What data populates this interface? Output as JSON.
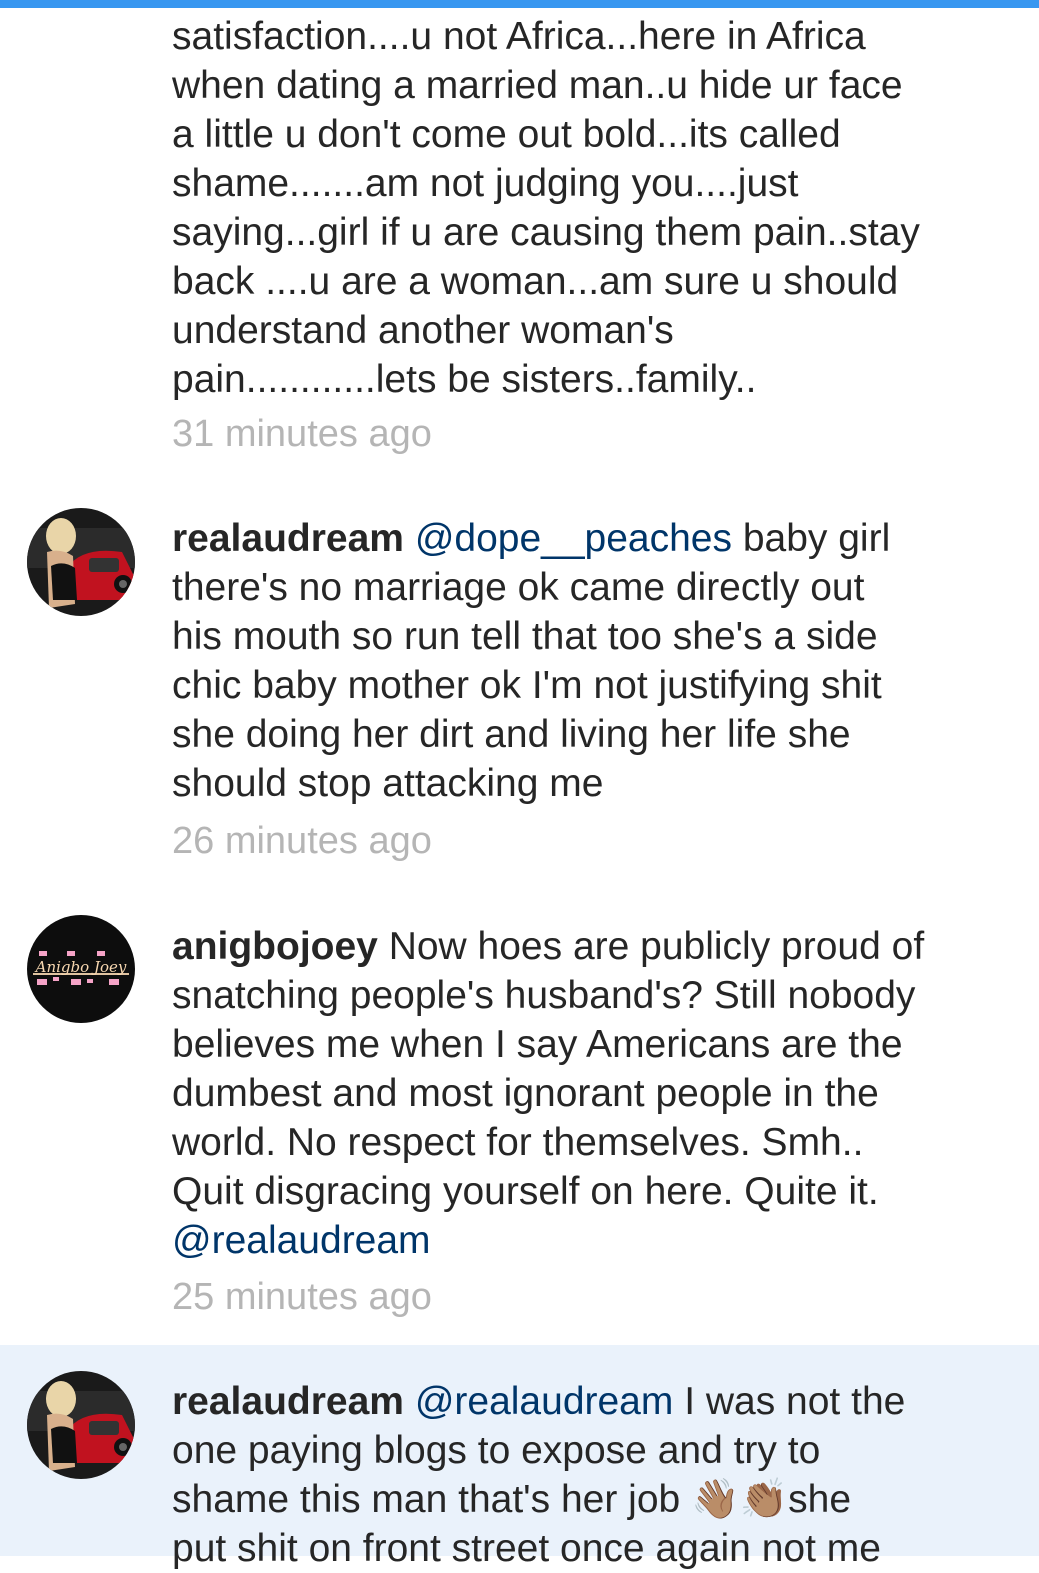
{
  "comments": [
    {
      "lines": [
        "satisfaction....u not Africa...here in Africa",
        "when dating a married man..u hide ur face",
        "a little u don't come out bold...its called",
        "shame.......am not judging you....just",
        "saying...girl if u are causing them pain..stay",
        "back ....u are a woman...am sure u should",
        "understand another woman's",
        "pain............lets be sisters..family.."
      ],
      "time": "31 minutes ago"
    },
    {
      "username": "realaudream",
      "mention": "@dope__peaches",
      "first_line_rest": " baby girl",
      "lines": [
        "there's no marriage ok came directly out",
        "his mouth so run tell that too she's a side",
        "chic baby mother ok I'm not justifying shit",
        "she doing her dirt and living her life she",
        "should stop attacking me"
      ],
      "time": "26 minutes ago"
    },
    {
      "username": "anigbojoey",
      "avatar_label": "Anigbo Joey",
      "first_line_rest": " Now hoes are publicly proud of",
      "lines": [
        "snatching people's husband's? Still nobody",
        "believes me when I say Americans are the",
        "dumbest and most ignorant people in the",
        "world.  No respect for themselves.  Smh..",
        "Quit disgracing yourself on here.  Quite it."
      ],
      "trailing_mention": "@realaudream",
      "time": "25 minutes ago"
    },
    {
      "username": "realaudream",
      "mention": "@realaudream",
      "first_line_rest": " I was not the",
      "lines": [
        "one paying blogs to expose and try to",
        "shame this man that's her job 👋🏽👏🏽she",
        "put shit on front street once again not me"
      ]
    }
  ],
  "colors": {
    "accent_bar": "#3897f0",
    "mention": "#003569",
    "timestamp": "#b5b5b5",
    "highlight_bg": "#eaf2fb"
  }
}
